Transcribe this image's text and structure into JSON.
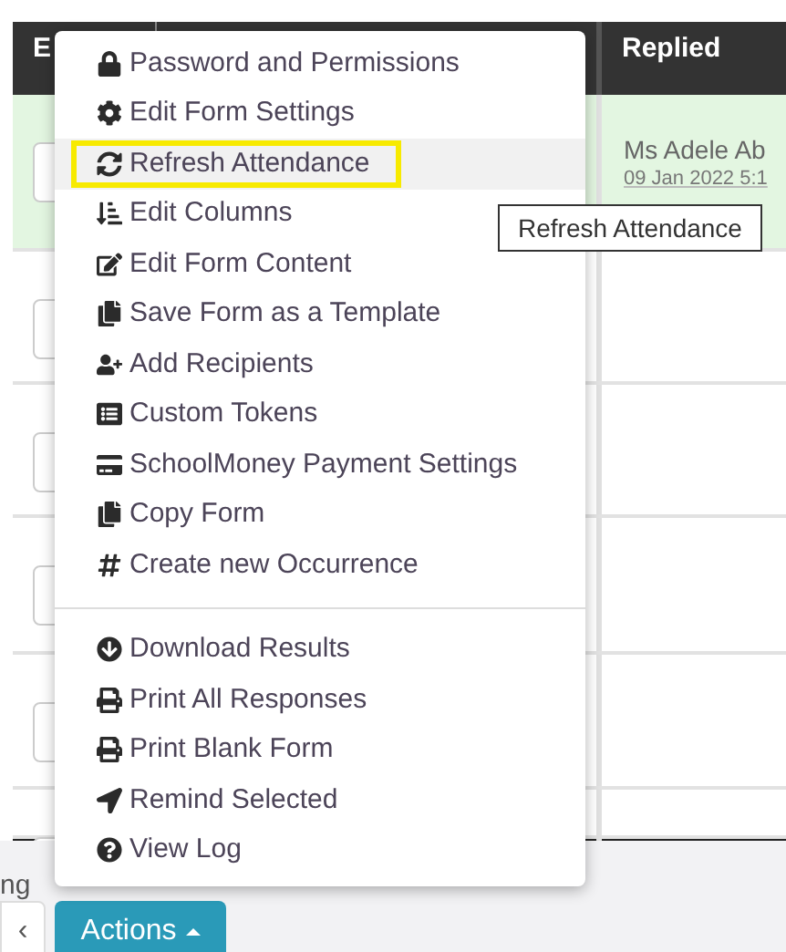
{
  "table": {
    "columns": [
      {
        "label": "E"
      },
      {
        "label": "Replied"
      }
    ],
    "rows": [
      {
        "highlighted": true,
        "replied_name": "Ms Adele Ab",
        "replied_date": "09 Jan 2022 5:1"
      },
      {
        "highlighted": false
      },
      {
        "highlighted": false
      },
      {
        "highlighted": false
      },
      {
        "highlighted": false
      },
      {
        "highlighted": false
      }
    ]
  },
  "actions_menu": {
    "groups": [
      [
        {
          "label": "Password and Permissions",
          "hovered": false,
          "outlined": false
        },
        {
          "label": "Edit Form Settings",
          "hovered": false,
          "outlined": false
        },
        {
          "label": "Refresh Attendance",
          "hovered": true,
          "outlined": true
        },
        {
          "label": "Edit Columns",
          "hovered": false,
          "outlined": false
        },
        {
          "label": "Edit Form Content",
          "hovered": false,
          "outlined": false
        },
        {
          "label": "Save Form as a Template",
          "hovered": false,
          "outlined": false
        },
        {
          "label": "Add Recipients",
          "hovered": false,
          "outlined": false
        },
        {
          "label": "Custom Tokens",
          "hovered": false,
          "outlined": false
        },
        {
          "label": "SchoolMoney Payment Settings",
          "hovered": false,
          "outlined": false
        },
        {
          "label": "Copy Form",
          "hovered": false,
          "outlined": false
        },
        {
          "label": "Create new Occurrence",
          "hovered": false,
          "outlined": false
        }
      ],
      [
        {
          "label": "Download Results",
          "hovered": false,
          "outlined": false
        },
        {
          "label": "Print All Responses",
          "hovered": false,
          "outlined": false
        },
        {
          "label": "Print Blank Form",
          "hovered": false,
          "outlined": false
        },
        {
          "label": "Remind Selected",
          "hovered": false,
          "outlined": false
        },
        {
          "label": "View Log",
          "hovered": false,
          "outlined": false
        }
      ]
    ]
  },
  "tooltip": "Refresh Attendance",
  "footer": {
    "status_text": "ng",
    "prev_button": "‹",
    "actions_button": "Actions"
  }
}
